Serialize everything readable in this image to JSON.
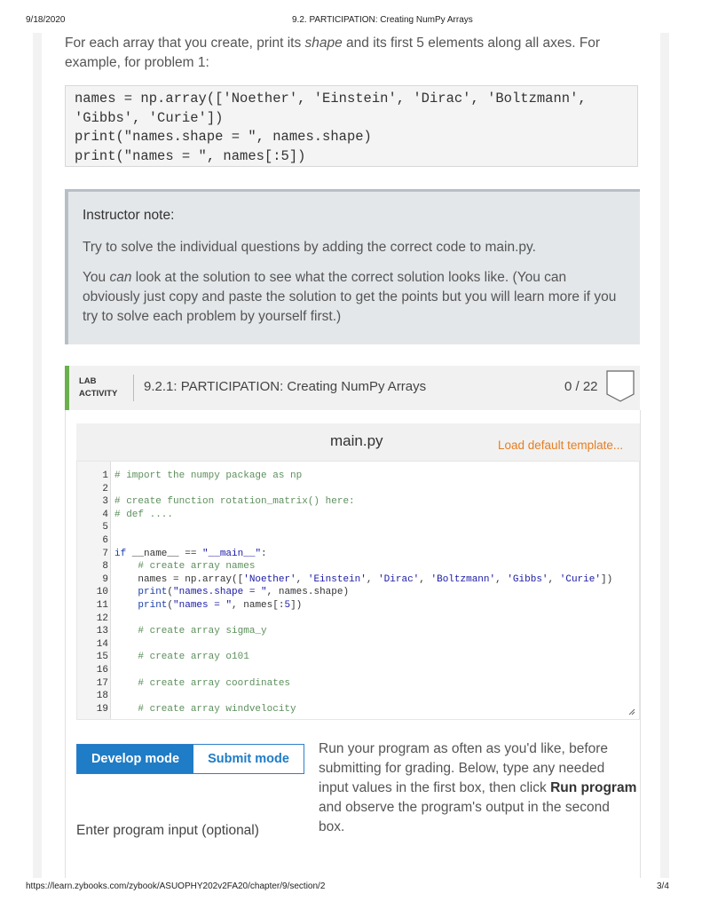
{
  "print_header": {
    "date": "9/18/2020",
    "title": "9.2. PARTICIPATION: Creating NumPy Arrays"
  },
  "print_footer": {
    "url": "https://learn.zybooks.com/zybook/ASUOPHY202v2FA20/chapter/9/section/2",
    "page": "3/4"
  },
  "intro": {
    "before": "For each array that you create, print its ",
    "em": "shape",
    "after": " and its first 5 elements along all axes. For example, for problem 1:"
  },
  "example_code": [
    "names = np.array(['Noether', 'Einstein', 'Dirac', 'Boltzmann',",
    "'Gibbs', 'Curie'])",
    "print(\"names.shape = \", names.shape)",
    "print(\"names = \", names[:5])"
  ],
  "instructor_note": {
    "title": "Instructor note:",
    "p1": "Try to solve the individual questions by adding the correct code to main.py.",
    "p2_before": "You ",
    "p2_em": "can",
    "p2_after": " look at the solution to see what the correct solution looks like. (You can obviously just copy and paste the solution to get the points but you will learn more if you try to solve each problem by yourself first.)"
  },
  "lab": {
    "tag_line1": "LAB",
    "tag_line2": "ACTIVITY",
    "title": "9.2.1: PARTICIPATION: Creating NumPy Arrays",
    "score": "0 / 22",
    "badge_icon": "empty-badge-icon"
  },
  "editor": {
    "filename": "main.py",
    "load_template": "Load default template...",
    "line_numbers": [
      "1",
      "2",
      "3",
      "4",
      "5",
      "6",
      "7",
      "8",
      "9",
      "10",
      "11",
      "12",
      "13",
      "14",
      "15",
      "16",
      "17",
      "18",
      "19"
    ],
    "lines": {
      "l1": "# import the numpy package as np",
      "l3": "# create function rotation_matrix() here:",
      "l4": "# def ....",
      "l7_kw": "if",
      "l7_a": " __name__ == ",
      "l7_str": "\"__main__\"",
      "l7_b": ":",
      "l8": "    # create array names",
      "l9_a": "    names = np.array([",
      "l9_s1": "'Noether'",
      "l9_s2": "'Einstein'",
      "l9_s3": "'Dirac'",
      "l9_s4": "'Boltzmann'",
      "l9_s5": "'Gibbs'",
      "l9_s6": "'Curie'",
      "l9_end": "])",
      "l10_kw": "print",
      "l10_str": "\"names.shape = \"",
      "l10_b": ", names.shape)",
      "l11_kw": "print",
      "l11_str": "\"names = \"",
      "l11_b": ", names[:",
      "l11_num": "5",
      "l11_c": "])",
      "l13": "    # create array sigma_y",
      "l15": "    # create array o101",
      "l17": "    # create array coordinates",
      "l19": "    # create array windvelocity"
    }
  },
  "modes": {
    "develop": "Develop mode",
    "submit": "Submit mode"
  },
  "run_info": {
    "before": "Run your program as often as you'd like, before submitting for grading. Below, type any needed input values in the first box, then click ",
    "bold": "Run program",
    "after": " and observe the program's output in the second box."
  },
  "input_label": "Enter program input (optional)",
  "colors": {
    "accent": "#1f7cc6",
    "lab_bar": "#6ab04c",
    "load_link": "#e67e22"
  }
}
